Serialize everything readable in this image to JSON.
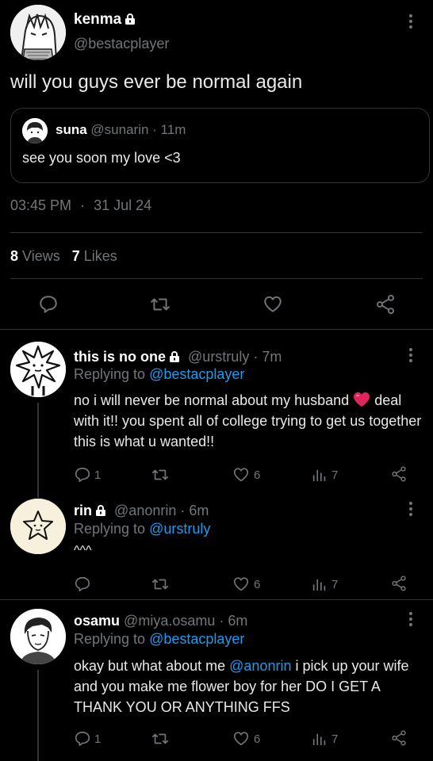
{
  "main_tweet": {
    "display_name": "kenma",
    "handle": "@bestacplayer",
    "text": "will you guys ever be normal again",
    "quote": {
      "display_name": "suna",
      "handle": "@sunarin",
      "time": "· 11m",
      "text": "see you soon my love <3"
    },
    "timestamp": "03:45 PM",
    "dot": "·",
    "date": "31 Jul 24",
    "views_count": "8",
    "views_label": "Views",
    "likes_count": "7",
    "likes_label": "Likes"
  },
  "replies": [
    {
      "display_name": "this is no one",
      "handle": "@urstruly",
      "time": "· 7m",
      "replying_label": "Replying to",
      "replying_to": "@bestacplayer",
      "text_before_heart": "no i will never be normal about my husband",
      "text_after_heart": "deal with it!! you spent all of college trying to get us together this is what u wanted!!",
      "replies": "1",
      "retweets": "",
      "likes": "6",
      "views": "7"
    },
    {
      "display_name": "rin",
      "handle": "@anonrin",
      "time": "· 6m",
      "replying_label": "Replying to",
      "replying_to": "@urstruly",
      "text": "^^^",
      "replies": "",
      "retweets": "",
      "likes": "6",
      "views": "7"
    },
    {
      "display_name": "osamu",
      "handle": "@miya.osamu",
      "time": "· 6m",
      "replying_label": "Replying to",
      "replying_to": "@bestacplayer",
      "text_before_mention": "okay but what about me",
      "mention": "@anonrin",
      "text_after_mention": "i pick up your wife and you make me flower boy for her DO I GET A THANK YOU OR ANYTHING FFS",
      "replies": "1",
      "retweets": "",
      "likes": "6",
      "views": "7"
    }
  ],
  "icons": {
    "lock": "lock-icon",
    "more": "more-icon",
    "reply": "reply-icon",
    "retweet": "retweet-icon",
    "like": "like-icon",
    "share": "share-icon",
    "views": "views-icon",
    "heart_emoji": "heart-emoji"
  },
  "colors": {
    "background": "#000000",
    "text": "#e7e9ea",
    "secondary": "#71767b",
    "link": "#1d9bf0",
    "divider": "#2f3336",
    "heart": "#e0245e"
  }
}
